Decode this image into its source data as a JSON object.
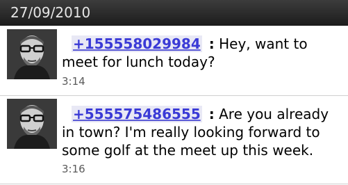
{
  "date_header": "27/09/2010",
  "messages": [
    {
      "sender": "+155558029984",
      "separator": ":",
      "text": "Hey, want to meet for lunch today?",
      "time": "3:14",
      "avatar_icon": "person-avatar-icon"
    },
    {
      "sender": "+555575486555",
      "separator": ":",
      "text": "Are you already in town? I'm really looking forward to some golf at the meet up this week.",
      "time": "3:16",
      "avatar_icon": "person-avatar-icon"
    }
  ],
  "colors": {
    "header_bg": "#2a2a2a",
    "header_text": "#e6e6e6",
    "sender_link": "#3a3ad6",
    "timestamp": "#5a5a5a",
    "divider": "#cfcfcf"
  }
}
